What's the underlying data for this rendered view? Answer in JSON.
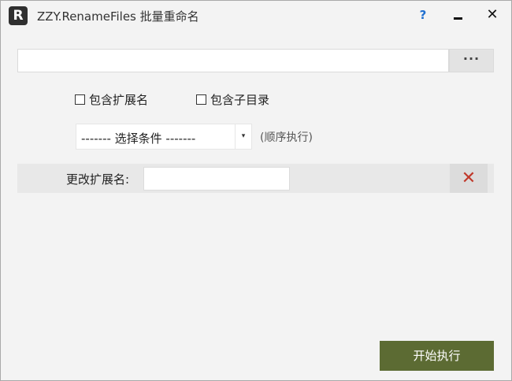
{
  "window": {
    "app_icon_letter": "R",
    "title": "ZZY.RenameFiles 批量重命名",
    "help_glyph": "?",
    "close_glyph": "✕"
  },
  "path": {
    "value": "",
    "placeholder": "",
    "browse_label": "···"
  },
  "options": {
    "include_ext_label": "包含扩展名",
    "include_ext_checked": false,
    "include_subdir_label": "包含子目录",
    "include_subdir_checked": false
  },
  "condition": {
    "selected": "------- 选择条件 -------",
    "arrow_glyph": "▾",
    "hint": "(顺序执行)"
  },
  "rule": {
    "label": "更改扩展名:",
    "value": "",
    "remove_glyph": "✕"
  },
  "actions": {
    "start_label": "开始执行"
  },
  "colors": {
    "start_button": "#5c6b33",
    "remove_icon": "#c0392b",
    "help_icon": "#1f6fd0"
  },
  "icons": {
    "app": "app-logo-icon",
    "help": "help-icon",
    "minimize": "minimize-icon",
    "close": "close-icon",
    "browse": "ellipsis-icon",
    "dropdown": "chevron-down-icon",
    "remove": "close-icon"
  }
}
